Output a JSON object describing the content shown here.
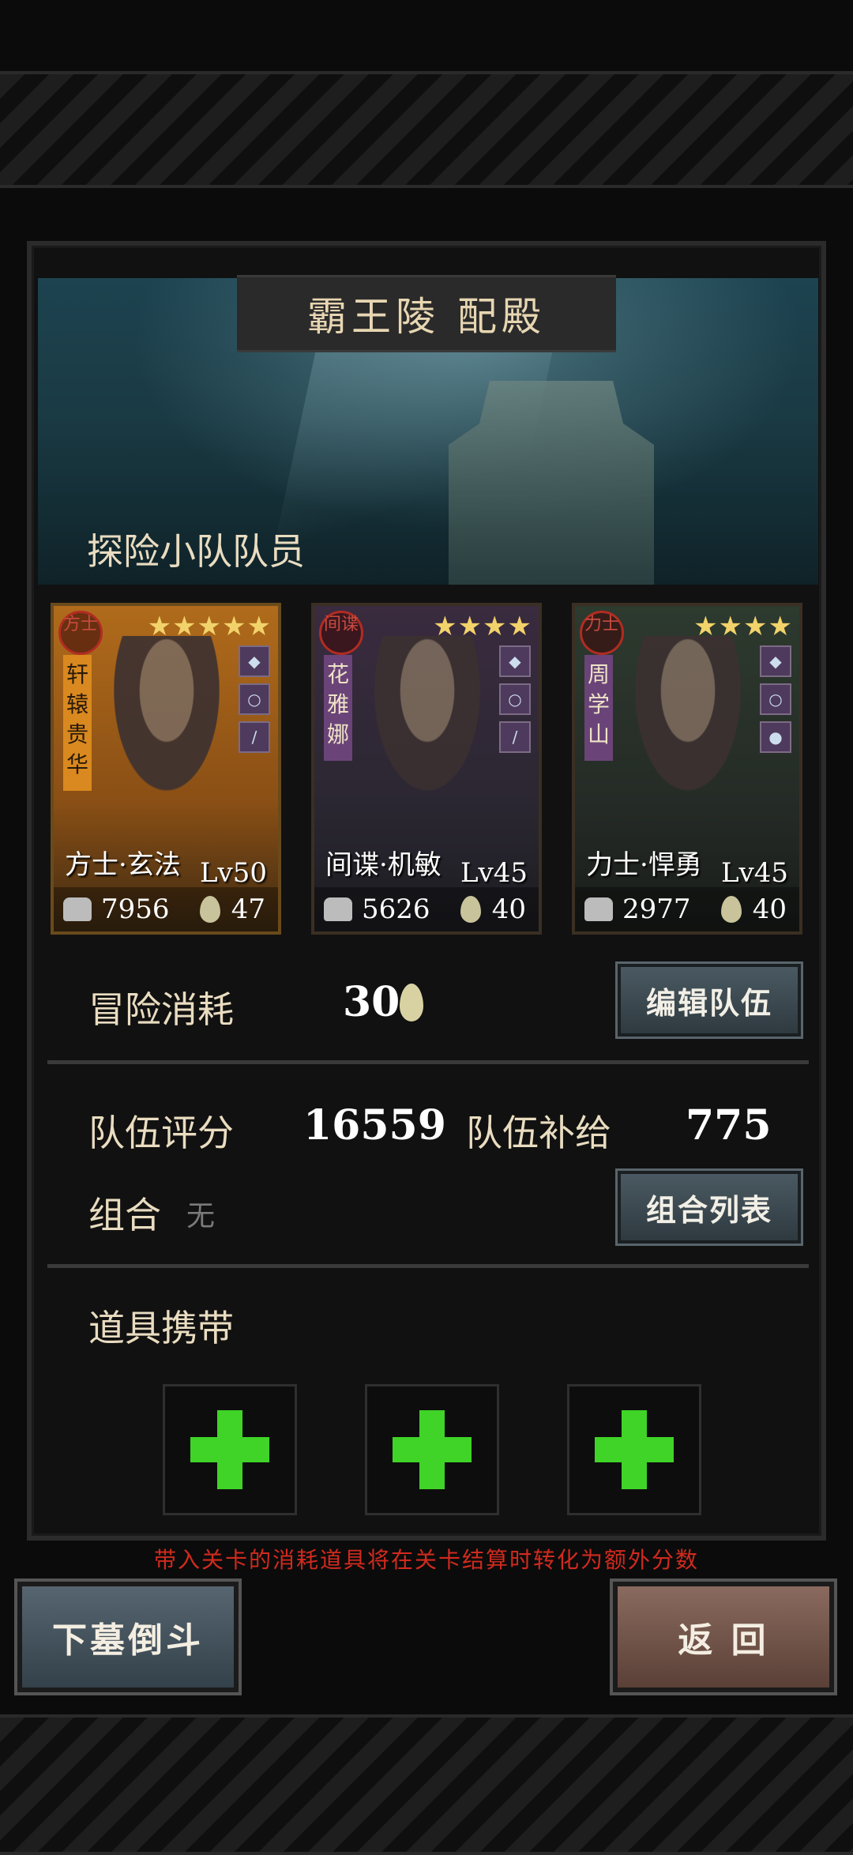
{
  "stage": {
    "title": "霸王陵  配殿"
  },
  "members_label": "探险小队队员",
  "members": [
    {
      "class_seal": "方士",
      "name_vertical": "轩辕贵华",
      "stars": "★★★★★",
      "display_name": "方士·玄法",
      "level": "Lv50",
      "power": "7956",
      "supply": "47",
      "rarity": "gold"
    },
    {
      "class_seal": "间谍",
      "name_vertical": "花雅娜",
      "stars": "★★★★",
      "display_name": "间谍·机敏",
      "level": "Lv45",
      "power": "5626",
      "supply": "40",
      "rarity": "purple"
    },
    {
      "class_seal": "力士",
      "name_vertical": "周学山",
      "stars": "★★★★",
      "display_name": "力士·悍勇",
      "level": "Lv45",
      "power": "2977",
      "supply": "40",
      "rarity": "green"
    }
  ],
  "adventure": {
    "label": "冒险消耗",
    "value": "30",
    "edit_button": "编辑队伍"
  },
  "team": {
    "score_label": "队伍评分",
    "score_value": "16559",
    "supply_label": "队伍补给",
    "supply_value": "775",
    "combo_label": "组合",
    "combo_value": "无",
    "combo_button": "组合列表"
  },
  "items": {
    "label": "道具携带",
    "slots": 3
  },
  "notice": "带入关卡的消耗道具将在关卡结算时转化为额外分数",
  "buttons": {
    "descend": "下墓倒斗",
    "return": "返 回"
  },
  "colors": {
    "accent_green": "#3fd427",
    "notice_red": "#d12a1e"
  }
}
